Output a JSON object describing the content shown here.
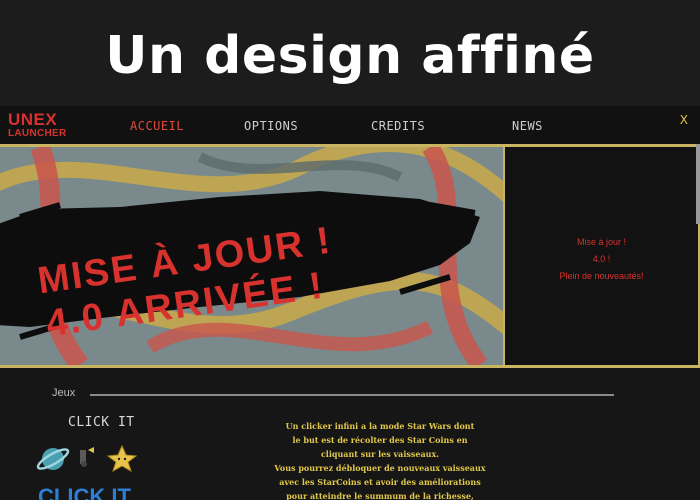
{
  "headline": "Un design affiné",
  "app": {
    "logo_line1": "UNEX",
    "logo_line2": "LAUNCHER",
    "nav": [
      "ACCUEIL",
      "OPTIONS",
      "CREDITS",
      "NEWS"
    ],
    "active_nav": "ACCUEIL",
    "close_label": "X"
  },
  "banner": {
    "line1": "MISE À JOUR !",
    "line2": "4.0 ARRIVÉE !"
  },
  "news_panel": {
    "lines": [
      "Mise à jour !",
      "4.0 !",
      "Plein de nouveautés!"
    ]
  },
  "games_section": {
    "label": "Jeux",
    "game_title": "CLICK IT",
    "game_logo_text": "CLICK IT",
    "description_lines": [
      "Un clicker infini a la mode Star Wars dont",
      "le but est de récolter des Star Coins en",
      "cliquant sur les vaisseaux.",
      "Vous pourrez débloquer de nouveaux vaisseaux",
      "avec les StarCoins et avoir des améliorations",
      "pour atteindre le summum de la richesse,"
    ]
  },
  "colors": {
    "accent_red": "#d8322e",
    "accent_gold": "#e2c84a",
    "background": "#161616"
  }
}
